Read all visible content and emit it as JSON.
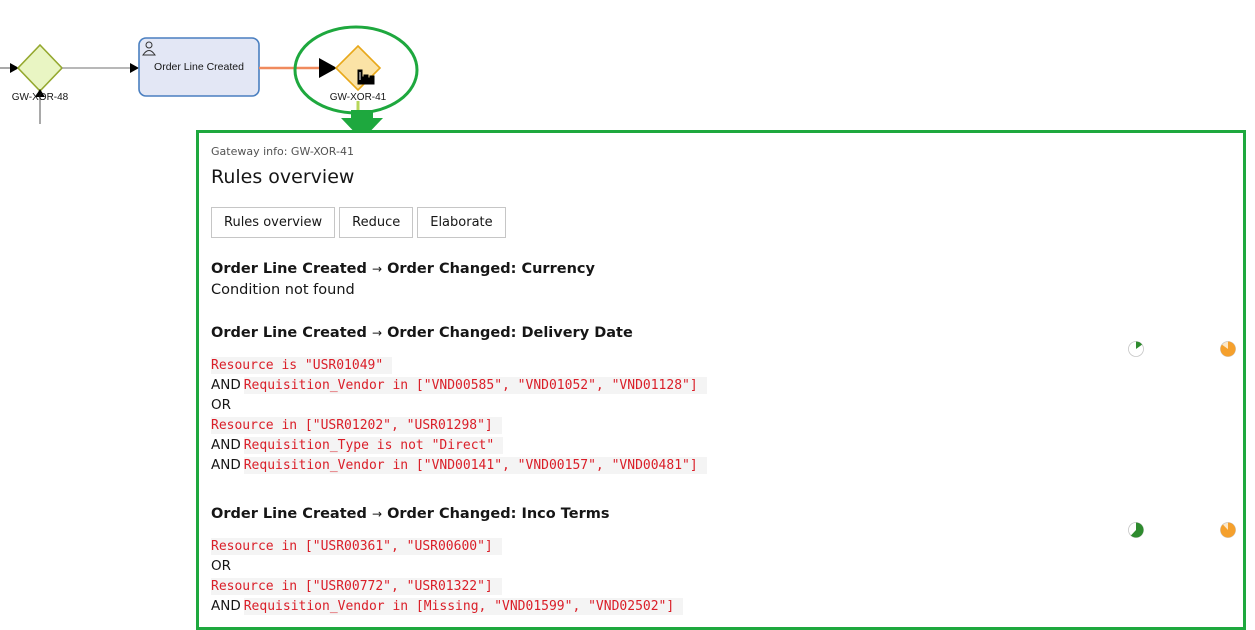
{
  "diagram": {
    "gateway_left": {
      "label": "GW-XOR-48"
    },
    "task": {
      "label": "Order Line Created"
    },
    "gateway_selected": {
      "label": "GW-XOR-41"
    }
  },
  "panel": {
    "gateway_info": "Gateway info: GW-XOR-41",
    "title": "Rules overview",
    "buttons": [
      "Rules overview",
      "Reduce",
      "Elaborate"
    ],
    "sections": [
      {
        "from": "Order Line Created",
        "arrow": "→",
        "to": "Order Changed: Currency",
        "note": "Condition not found"
      },
      {
        "from": "Order Line Created",
        "arrow": "→",
        "to": "Order Changed: Delivery Date",
        "lines": [
          {
            "kw": "",
            "code": "Resource is \"USR01049\""
          },
          {
            "kw": "AND",
            "code": "Requisition_Vendor in [\"VND00585\", \"VND01052\", \"VND01128\"]"
          },
          {
            "kw": "OR",
            "code": ""
          },
          {
            "kw": "",
            "code": "Resource in [\"USR01202\", \"USR01298\"]"
          },
          {
            "kw": "AND",
            "code": "Requisition_Type is not \"Direct\""
          },
          {
            "kw": "AND",
            "code": "Requisition_Vendor in [\"VND00141\", \"VND00157\", \"VND00481\"]"
          }
        ]
      },
      {
        "from": "Order Line Created",
        "arrow": "→",
        "to": "Order Changed: Inco Terms",
        "lines": [
          {
            "kw": "",
            "code": "Resource in [\"USR00361\", \"USR00600\"]"
          },
          {
            "kw": "OR",
            "code": ""
          },
          {
            "kw": "",
            "code": "Resource in [\"USR00772\", \"USR01322\"]"
          },
          {
            "kw": "AND",
            "code": "Requisition_Vendor in [Missing, \"VND01599\", \"VND02502\"]"
          }
        ]
      }
    ],
    "indicators": [
      {
        "green_fraction": 0.15,
        "orange_fraction": 0.85
      },
      {
        "green_fraction": 0.62,
        "orange_fraction": 0.88
      }
    ]
  },
  "colors": {
    "panel_border": "#1ea83e",
    "highlight_ring": "#1ea83e",
    "code_text": "#da1e28",
    "pie_green": "#2e8b2e",
    "pie_orange": "#f5a02c",
    "gateway_fill": "#e9f5c3",
    "gateway_selected_fill": "#fbe3a6",
    "task_fill": "#e3e7f5",
    "task_stroke": "#4a7fc0"
  },
  "icons": {
    "task_type": "user-icon",
    "cursor": "hand-cursor-icon",
    "pointer": "down-arrow-icon"
  }
}
